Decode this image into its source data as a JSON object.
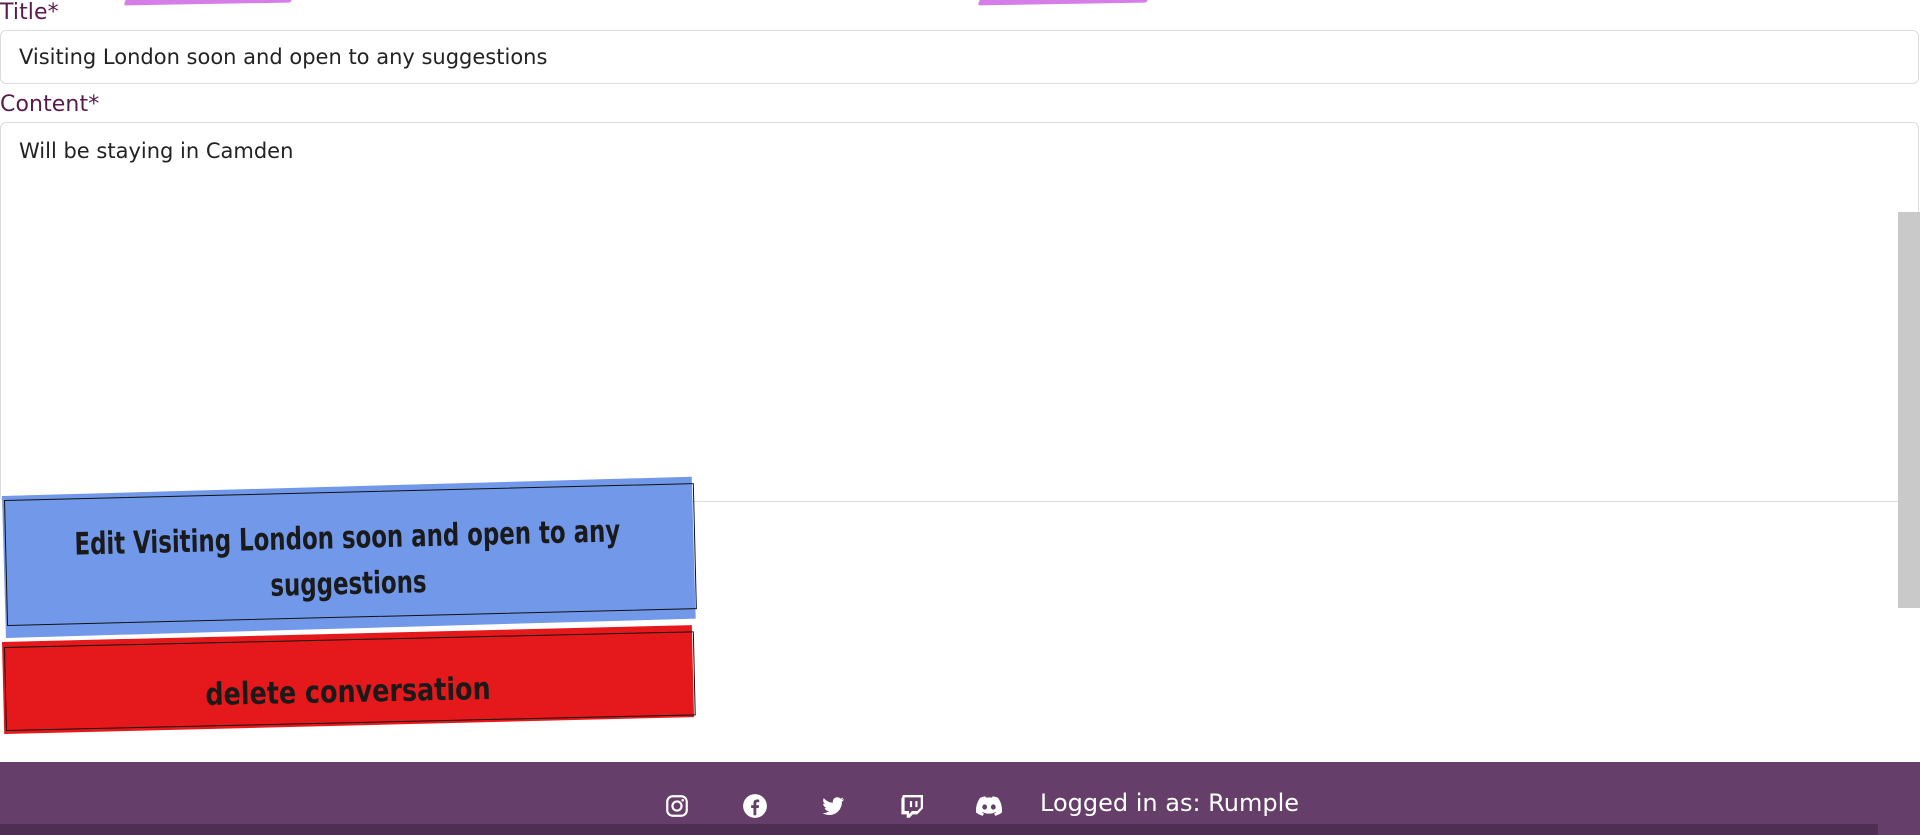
{
  "form": {
    "title_label": "Title*",
    "title_value": "Visiting London soon and open to any suggestions",
    "content_label": "Content*",
    "content_value": "Will be staying in Camden"
  },
  "actions": {
    "edit_label": "Edit Visiting London soon and open to any suggestions",
    "delete_label": "delete conversation"
  },
  "footer": {
    "icons": [
      "instagram-icon",
      "facebook-icon",
      "twitter-icon",
      "twitch-icon",
      "discord-icon"
    ],
    "login_text": "Logged in as: Rumple"
  },
  "colors": {
    "label": "#5a1b4c",
    "edit_button": "#7298e9",
    "delete_button": "#e5191c",
    "footer": "#653f6a",
    "accent_deco": "#d67ee8"
  }
}
